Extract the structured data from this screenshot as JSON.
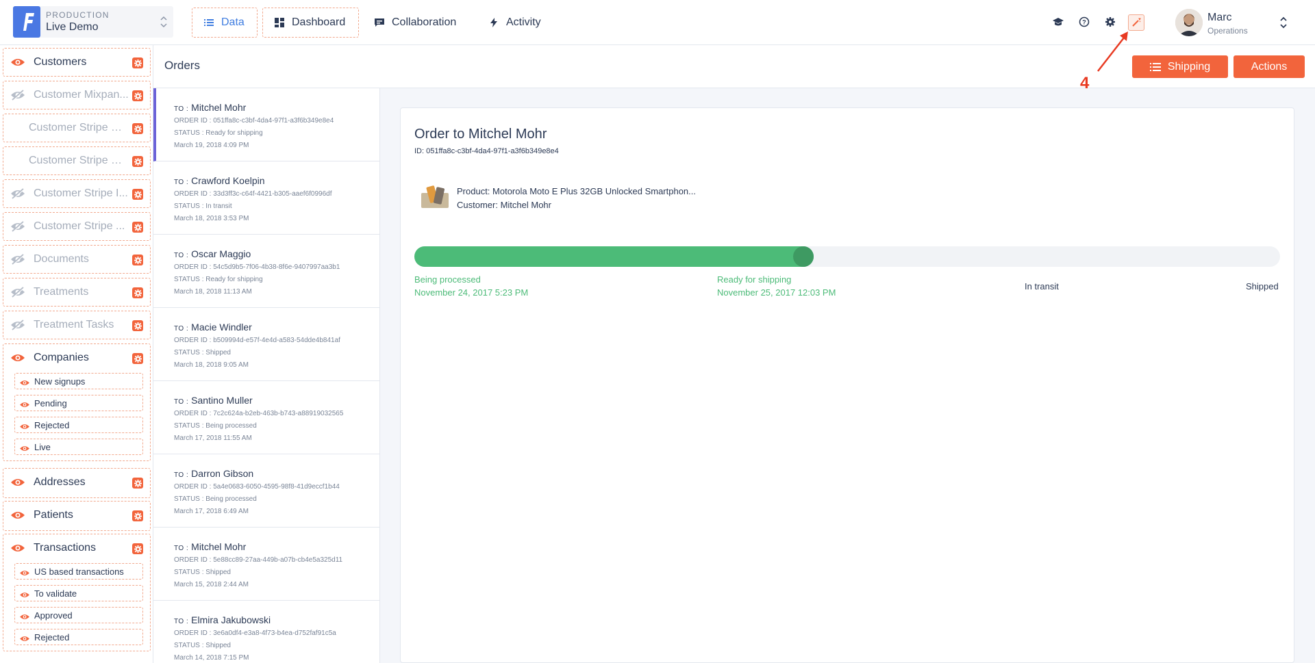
{
  "env": {
    "label": "PRODUCTION",
    "name": "Live Demo"
  },
  "nav": [
    {
      "label": "Data",
      "icon": "list-icon",
      "active": true
    },
    {
      "label": "Dashboard",
      "icon": "dashboard-icon",
      "active": false
    },
    {
      "label": "Collaboration",
      "icon": "chat-icon",
      "active": false
    },
    {
      "label": "Activity",
      "icon": "bolt-icon",
      "active": false
    }
  ],
  "user": {
    "name": "Marc",
    "role": "Operations"
  },
  "annotation": {
    "number": "4"
  },
  "sidebar": {
    "items": [
      {
        "label": "Customers",
        "hidden": false
      },
      {
        "label": "Customer Mixpan...",
        "hidden": true
      },
      {
        "label": "Customer Stripe B...",
        "hidden": true,
        "noeye": true
      },
      {
        "label": "Customer Stripe C...",
        "hidden": true,
        "noeye": true
      },
      {
        "label": "Customer Stripe I...",
        "hidden": true
      },
      {
        "label": "Customer Stripe ...",
        "hidden": true
      },
      {
        "label": "Documents",
        "hidden": true
      },
      {
        "label": "Treatments",
        "hidden": true
      },
      {
        "label": "Treatment Tasks",
        "hidden": true
      }
    ],
    "companies": {
      "label": "Companies",
      "segments": [
        "New signups",
        "Pending",
        "Rejected",
        "Live"
      ]
    },
    "addresses": {
      "label": "Addresses"
    },
    "patients": {
      "label": "Patients"
    },
    "transactions": {
      "label": "Transactions",
      "segments": [
        "US based transactions",
        "To validate",
        "Approved",
        "Rejected"
      ]
    }
  },
  "main": {
    "title": "Orders",
    "shipping_label": "Shipping",
    "actions_label": "Actions"
  },
  "orders": [
    {
      "to": "Mitchel Mohr",
      "id": "ORDER ID : 051ffa8c-c3bf-4da4-97f1-a3f6b349e8e4",
      "status": "STATUS : Ready for shipping",
      "date": "March 19, 2018 4:09 PM"
    },
    {
      "to": "Crawford Koelpin",
      "id": "ORDER ID : 33d3ff3c-c64f-4421-b305-aaef6f0996df",
      "status": "STATUS : In transit",
      "date": "March 18, 2018 3:53 PM"
    },
    {
      "to": "Oscar Maggio",
      "id": "ORDER ID : 54c5d9b5-7f06-4b38-8f6e-9407997aa3b1",
      "status": "STATUS : Ready for shipping",
      "date": "March 18, 2018 11:13 AM"
    },
    {
      "to": "Macie Windler",
      "id": "ORDER ID : b509994d-e57f-4e4d-a583-54dde4b841af",
      "status": "STATUS : Shipped",
      "date": "March 18, 2018 9:05 AM"
    },
    {
      "to": "Santino Muller",
      "id": "ORDER ID : 7c2c624a-b2eb-463b-b743-a88919032565",
      "status": "STATUS : Being processed",
      "date": "March 17, 2018 11:55 AM"
    },
    {
      "to": "Darron Gibson",
      "id": "ORDER ID : 5a4e0683-6050-4595-98f8-41d9eccf1b44",
      "status": "STATUS : Being processed",
      "date": "March 17, 2018 6:49 AM"
    },
    {
      "to": "Mitchel Mohr",
      "id": "ORDER ID : 5e88cc89-27aa-449b-a07b-cb4e5a325d11",
      "status": "STATUS : Shipped",
      "date": "March 15, 2018 2:44 AM"
    },
    {
      "to": "Elmira Jakubowski",
      "id": "ORDER ID : 3e6a0df4-e3a8-4f73-b4ea-d752faf91c5a",
      "status": "STATUS : Shipped",
      "date": "March 14, 2018 7:15 PM"
    }
  ],
  "to_prefix": "TO :",
  "detail": {
    "title": "Order to Mitchel Mohr",
    "id": "ID: 051ffa8c-c3bf-4da4-97f1-a3f6b349e8e4",
    "product": "Product: Motorola Moto E Plus 32GB Unlocked Smartphon...",
    "customer": "Customer: Mitchel Mohr",
    "progress": 0.45,
    "steps": [
      {
        "label": "Being processed",
        "date": "November 24, 2017 5:23 PM"
      },
      {
        "label": "Ready for shipping",
        "date": "November 25, 2017 12:03 PM"
      },
      {
        "label": "In transit",
        "date": ""
      },
      {
        "label": "Shipped",
        "date": ""
      }
    ]
  },
  "colors": {
    "accent": "#f2643c",
    "progress": "#4cbb78",
    "primary": "#3f7de0"
  }
}
